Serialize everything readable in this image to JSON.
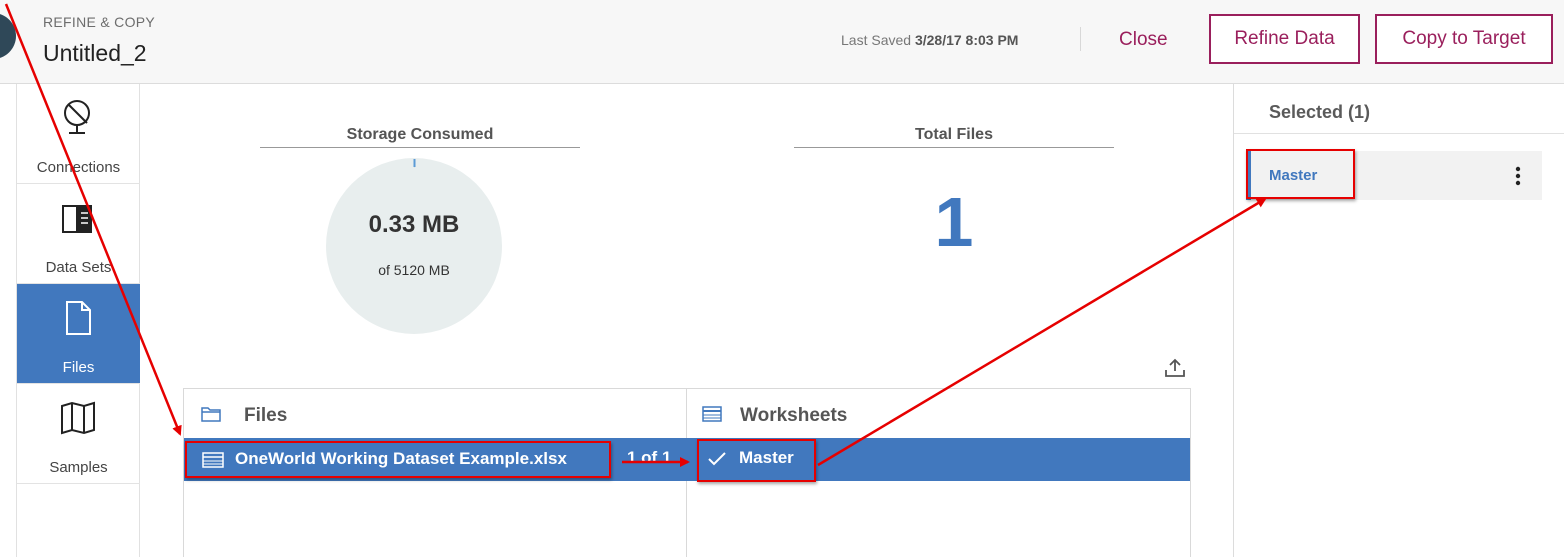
{
  "header": {
    "app_label": "REFINE & COPY",
    "title": "Untitled_2",
    "last_saved_label": "Last Saved",
    "last_saved_value": "3/28/17 8:03 PM",
    "close_label": "Close",
    "refine_label": "Refine Data",
    "copy_label": "Copy to Target"
  },
  "sidebar": {
    "items": [
      {
        "label": "Connections",
        "icon": "connections-icon",
        "active": false
      },
      {
        "label": "Data Sets",
        "icon": "data-sets-icon",
        "active": false
      },
      {
        "label": "Files",
        "icon": "file-icon",
        "active": true
      },
      {
        "label": "Samples",
        "icon": "samples-icon",
        "active": false
      }
    ]
  },
  "stats": {
    "storage_title": "Storage Consumed",
    "storage_value": "0.33 MB",
    "storage_of": "of 5120 MB",
    "storage_used_fraction": 6.45e-05,
    "files_title": "Total Files",
    "files_count": "1"
  },
  "browser": {
    "files_header": "Files",
    "worksheets_header": "Worksheets",
    "selected_file": "OneWorld Working Dataset Example.xlsx",
    "file_count": "1 of 1",
    "selected_worksheet": "Master"
  },
  "selected_panel": {
    "title": "Selected (1)",
    "items": [
      "Master"
    ]
  },
  "colors": {
    "accent": "#9a1f5c",
    "primary": "#4178be",
    "annotation": "#e60000"
  }
}
